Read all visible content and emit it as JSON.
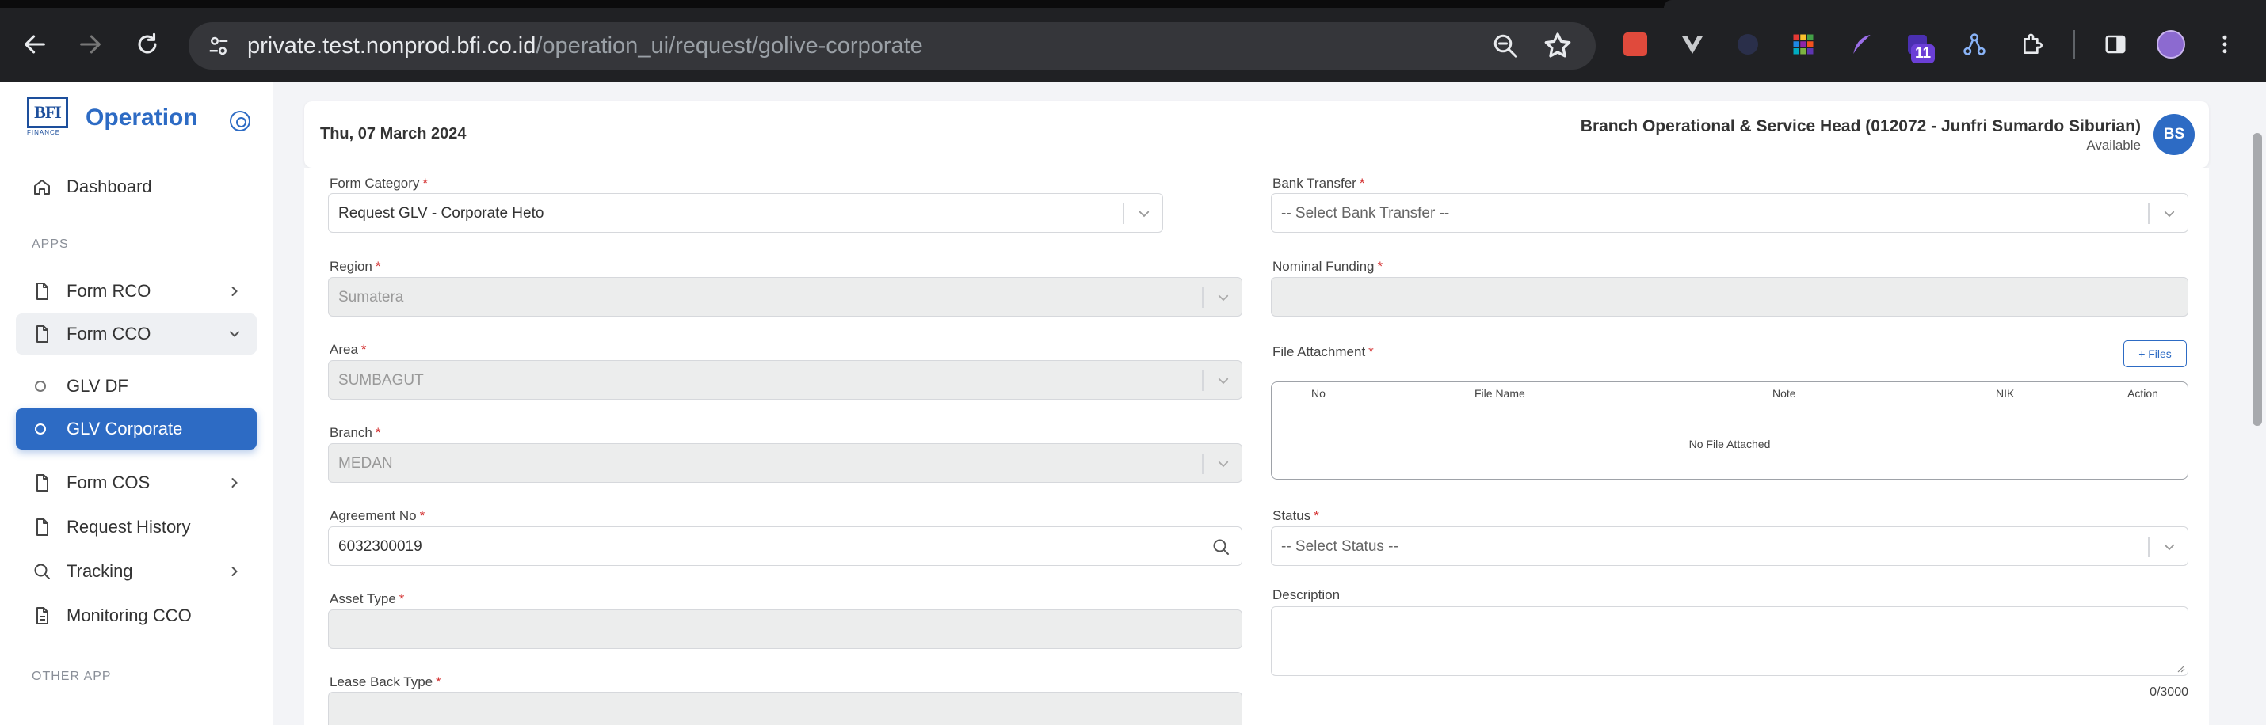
{
  "browser": {
    "url_host": "private.test.nonprod.bfi.co.id",
    "url_path": "/operation_ui/request/golive-corporate",
    "extension_badge": "11"
  },
  "sidebar": {
    "logo_text": "BFI",
    "logo_subtext": "FINANCE",
    "app_name": "Operation",
    "dashboard": "Dashboard",
    "section_apps": "APPS",
    "form_rco": "Form RCO",
    "form_cco": "Form CCO",
    "glv_df": "GLV DF",
    "glv_corporate": "GLV Corporate",
    "form_cos": "Form COS",
    "request_history": "Request History",
    "tracking": "Tracking",
    "monitoring_cco": "Monitoring CCO",
    "section_other": "OTHER APP"
  },
  "header": {
    "date": "Thu, 07 March 2024",
    "user_name": "Branch Operational & Service Head (012072 - Junfri Sumardo Siburian)",
    "user_status": "Available",
    "avatar_initials": "BS"
  },
  "form": {
    "required_mark": "*",
    "form_category": {
      "label": "Form Category",
      "value": "Request GLV - Corporate Heto"
    },
    "region": {
      "label": "Region",
      "value": "Sumatera"
    },
    "area": {
      "label": "Area",
      "value": "SUMBAGUT"
    },
    "branch": {
      "label": "Branch",
      "value": "MEDAN"
    },
    "agreement_no": {
      "label": "Agreement No",
      "value": "6032300019"
    },
    "asset_type": {
      "label": "Asset Type",
      "value": ""
    },
    "lease_back_type": {
      "label": "Lease Back Type",
      "value": ""
    },
    "bank_transfer": {
      "label": "Bank Transfer",
      "placeholder": "-- Select Bank Transfer --"
    },
    "nominal_funding": {
      "label": "Nominal Funding",
      "value": ""
    },
    "file_attachment": {
      "label": "File Attachment",
      "add_button": "+ Files",
      "columns": [
        "No",
        "File Name",
        "Note",
        "NIK",
        "Action"
      ],
      "empty_text": "No File Attached"
    },
    "status": {
      "label": "Status",
      "placeholder": "-- Select Status --"
    },
    "description": {
      "label": "Description",
      "counter": "0/3000"
    }
  }
}
